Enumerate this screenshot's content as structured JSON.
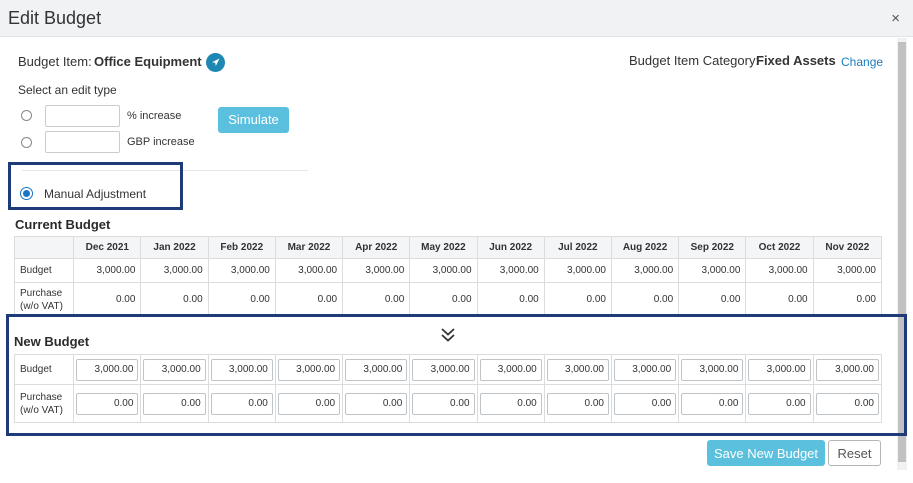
{
  "dialog": {
    "title": "Edit Budget",
    "close_glyph": "×"
  },
  "item": {
    "label": "Budget Item:",
    "value": "Office Equipment",
    "icon": "navigate-arrow-icon"
  },
  "category": {
    "label": "Budget Item Category:",
    "value": "Fixed Assets",
    "change_link": "Change"
  },
  "edit_type": {
    "heading": "Select an edit type",
    "percent_label": "% increase",
    "gbp_label": "GBP  increase",
    "percent_value": "",
    "gbp_value": "",
    "simulate_label": "Simulate",
    "manual_label": "Manual Adjustment",
    "selected": "manual"
  },
  "current_budget": {
    "title": "Current Budget",
    "months": [
      "Dec 2021",
      "Jan 2022",
      "Feb 2022",
      "Mar 2022",
      "Apr 2022",
      "May 2022",
      "Jun 2022",
      "Jul 2022",
      "Aug 2022",
      "Sep 2022",
      "Oct 2022",
      "Nov 2022"
    ],
    "rows": [
      {
        "label": "Budget",
        "values": [
          "3,000.00",
          "3,000.00",
          "3,000.00",
          "3,000.00",
          "3,000.00",
          "3,000.00",
          "3,000.00",
          "3,000.00",
          "3,000.00",
          "3,000.00",
          "3,000.00",
          "3,000.00"
        ]
      },
      {
        "label": "Purchase (w/o VAT)",
        "values": [
          "0.00",
          "0.00",
          "0.00",
          "0.00",
          "0.00",
          "0.00",
          "0.00",
          "0.00",
          "0.00",
          "0.00",
          "0.00",
          "0.00"
        ]
      }
    ]
  },
  "new_budget": {
    "title": "New Budget",
    "rows": [
      {
        "label": "Budget",
        "values": [
          "3,000.00",
          "3,000.00",
          "3,000.00",
          "3,000.00",
          "3,000.00",
          "3,000.00",
          "3,000.00",
          "3,000.00",
          "3,000.00",
          "3,000.00",
          "3,000.00",
          "3,000.00"
        ]
      },
      {
        "label": "Purchase (w/o VAT)",
        "values": [
          "0.00",
          "0.00",
          "0.00",
          "0.00",
          "0.00",
          "0.00",
          "0.00",
          "0.00",
          "0.00",
          "0.00",
          "0.00",
          "0.00"
        ]
      }
    ]
  },
  "actions": {
    "save_label": "Save New Budget",
    "reset_label": "Reset"
  },
  "colors": {
    "accent": "#5bc0de",
    "link": "#1a7ec0",
    "highlight_border": "#1f3a78",
    "nav_icon": "#1e88b4"
  }
}
